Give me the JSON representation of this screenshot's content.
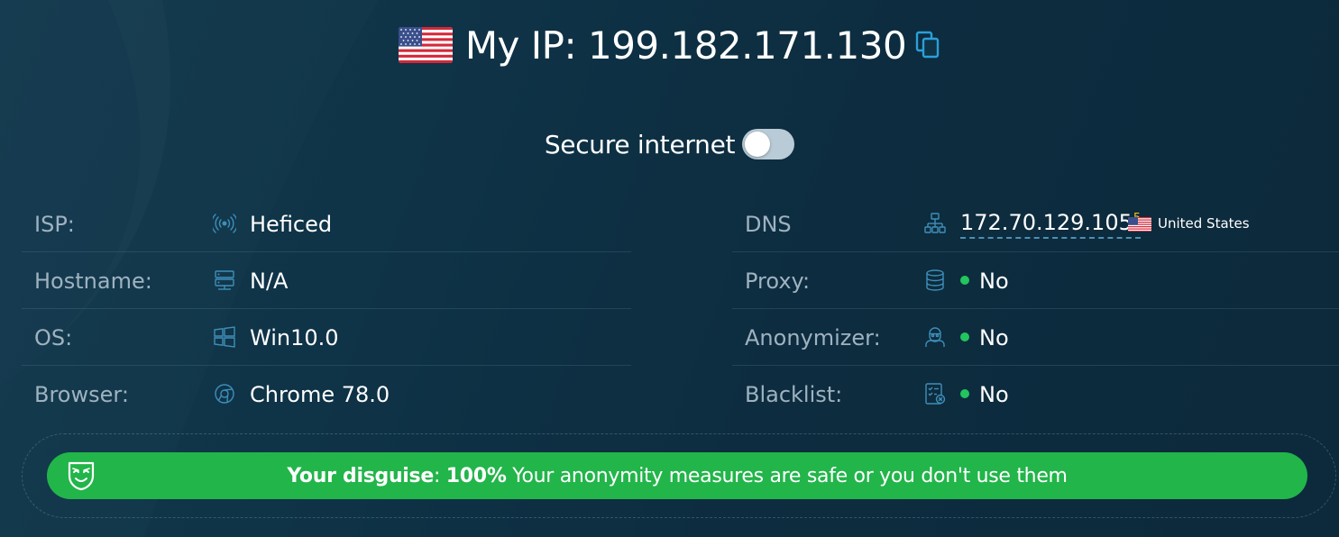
{
  "header": {
    "title": "My IP: 199.182.171.130",
    "flag_icon": "us-flag-icon",
    "copy_icon": "copy-icon"
  },
  "secure_internet": {
    "label": "Secure internet",
    "enabled": false
  },
  "left_rows": [
    {
      "label": "ISP:",
      "icon": "wifi-signal-icon",
      "value": "Heficed"
    },
    {
      "label": "Hostname:",
      "icon": "server-icon",
      "value": "N/A"
    },
    {
      "label": "OS:",
      "icon": "windows-icon",
      "value": "Win10.0"
    },
    {
      "label": "Browser:",
      "icon": "chrome-icon",
      "value": "Chrome 78.0"
    }
  ],
  "right_rows": [
    {
      "label": "DNS",
      "icon": "network-icon",
      "value": "172.70.129.105",
      "count": "5",
      "country": "United States",
      "flag_icon": "us-flag-icon"
    },
    {
      "label": "Proxy:",
      "icon": "database-icon",
      "value": "No"
    },
    {
      "label": "Anonymizer:",
      "icon": "hacker-icon",
      "value": "No"
    },
    {
      "label": "Blacklist:",
      "icon": "checklist-icon",
      "value": "No"
    }
  ],
  "banner": {
    "icon": "mask-icon",
    "lead": "Your disguise",
    "separator": ":",
    "percent": "100%",
    "message": "Your anonymity measures are safe or you don't use them"
  },
  "colors": {
    "background": "#0f3347",
    "accent_green": "#22b54a",
    "status_dot": "#22c55e",
    "label_gray": "#9fb2c0",
    "count_yellow": "#f5c518"
  }
}
